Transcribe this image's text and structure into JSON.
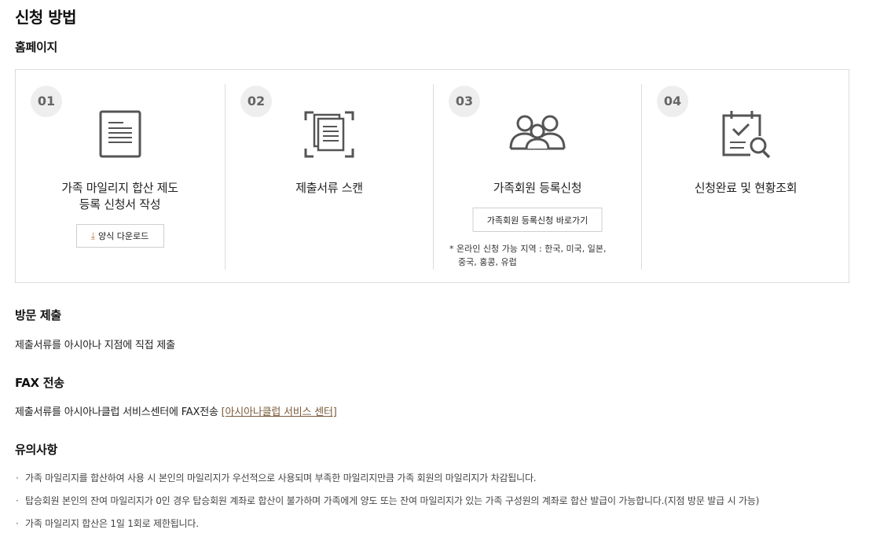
{
  "page_title": "신청 방법",
  "homepage": {
    "heading": "홈페이지",
    "steps": [
      {
        "number": "01",
        "icon": "document-form-icon",
        "title_lines": [
          "가족 마일리지 합산 제도",
          "등록 신청서 작성"
        ],
        "button": "양식 다운로드"
      },
      {
        "number": "02",
        "icon": "scan-document-icon",
        "title_lines": [
          "제출서류 스캔"
        ]
      },
      {
        "number": "03",
        "icon": "family-group-icon",
        "title_lines": [
          "가족회원 등록신청"
        ],
        "button": "가족회원 등록신청 바로가기",
        "note_lines": [
          "* 온라인 신청 가능 지역 : 한국, 미국, 일본,",
          "중국, 홍콩, 유럽"
        ]
      },
      {
        "number": "04",
        "icon": "clipboard-check-search-icon",
        "title_lines": [
          "신청완료 및 현황조회"
        ]
      }
    ]
  },
  "visit": {
    "heading": "방문 제출",
    "text": "제출서류를 아시아나 지점에 직접 제출"
  },
  "fax": {
    "heading": "FAX 전송",
    "text": "제출서류를 아시아나클럽 서비스센터에 FAX전송",
    "link": "[아시아나클럽 서비스 센터]"
  },
  "notice": {
    "heading": "유의사항",
    "items": [
      "가족 마일리지를 합산하여 사용 시 본인의 마일리지가 우선적으로 사용되며 부족한 마일리지만큼 가족 회원의 마일리지가 차감됩니다.",
      " 탑승회원 본인의 잔여 마일리지가 0인 경우 탑승회원 계좌로 합산이 불가하며 가족에게 양도 또는 잔여 마일리지가 있는 가족 구성원의 계좌로 합산 발급이 가능합니다.(지점 방문 발급 시 가능)",
      "가족 마일리지 합산은 1일 1회로 제한됩니다."
    ]
  }
}
